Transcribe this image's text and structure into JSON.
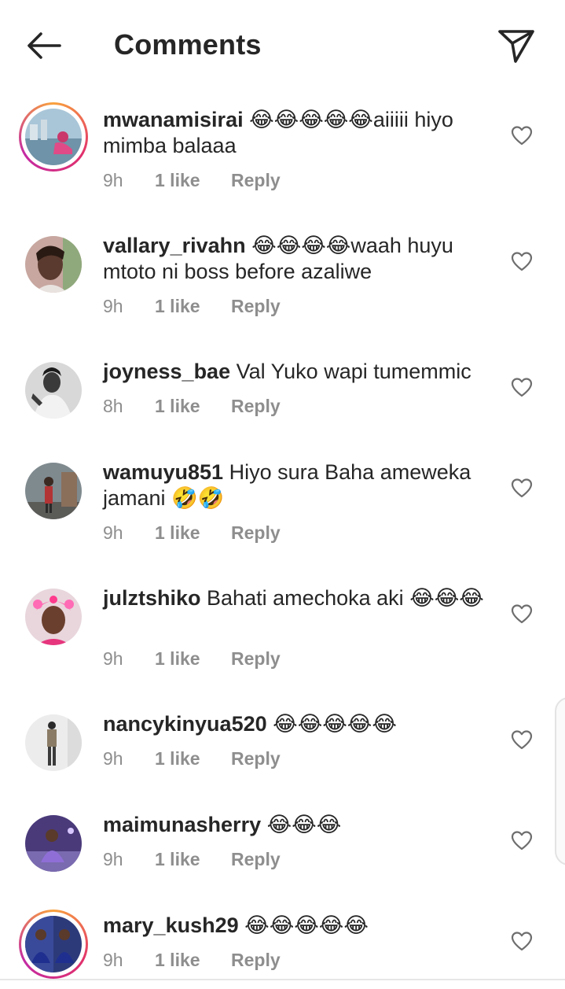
{
  "header": {
    "title": "Comments",
    "back_icon": "arrow-left-icon",
    "send_icon": "paper-plane-icon"
  },
  "colors": {
    "text": "#262626",
    "muted": "#8e8e8e",
    "story_ring": [
      "#f9a23c",
      "#e1306c",
      "#c32aa3"
    ]
  },
  "comments": [
    {
      "username": "mwanamisirai",
      "emojis": "😂😂😂😂😂",
      "text": "aiiiii hiyo mimba balaaa",
      "time": "9h",
      "likes": "1 like",
      "reply": "Reply",
      "has_story": true
    },
    {
      "username": "vallary_rivahn",
      "emojis": "😂😂😂😂",
      "text": "waah huyu mtoto ni boss before azaliwe",
      "time": "9h",
      "likes": "1 like",
      "reply": "Reply",
      "has_story": false
    },
    {
      "username": "joyness_bae",
      "emojis": "",
      "text": "Val Yuko wapi tumemmic",
      "time": "8h",
      "likes": "1 like",
      "reply": "Reply",
      "has_story": false
    },
    {
      "username": "wamuyu851",
      "emojis": "",
      "text": "Hiyo sura Baha ameweka jamani",
      "trailing_emojis": "🤣🤣",
      "time": "9h",
      "likes": "1 like",
      "reply": "Reply",
      "has_story": false
    },
    {
      "username": "julztshiko",
      "emojis": "",
      "text": "Bahati amechoka aki",
      "trailing_emojis": "😂😂😂",
      "time": "9h",
      "likes": "1 like",
      "reply": "Reply",
      "has_story": false
    },
    {
      "username": "nancykinyua520",
      "emojis": "😂😂😂😂😂",
      "text": "",
      "time": "9h",
      "likes": "1 like",
      "reply": "Reply",
      "has_story": false
    },
    {
      "username": "maimunasherry",
      "emojis": "😂😂😂",
      "text": "",
      "time": "9h",
      "likes": "1 like",
      "reply": "Reply",
      "has_story": false
    },
    {
      "username": "mary_kush29",
      "emojis": "😂😂😂😂😂",
      "text": "",
      "time": "9h",
      "likes": "1 like",
      "reply": "Reply",
      "has_story": true
    }
  ]
}
